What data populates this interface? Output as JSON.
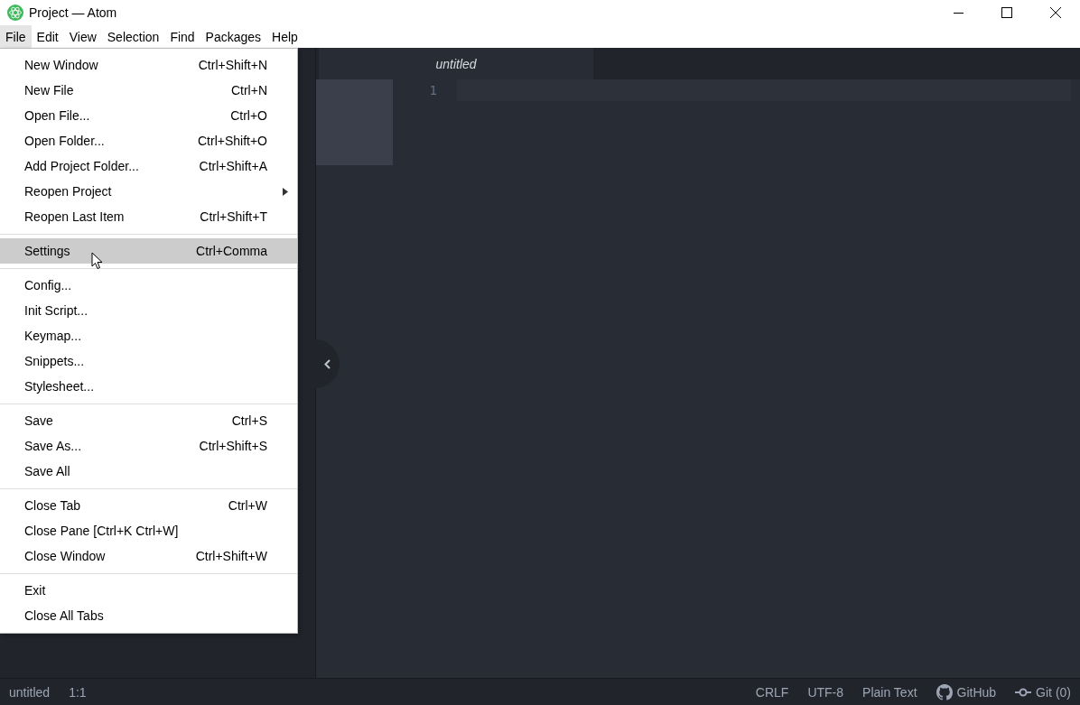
{
  "window": {
    "title": "Project — Atom"
  },
  "menu_bar": [
    {
      "label": "File",
      "selected": true
    },
    {
      "label": "Edit",
      "selected": false
    },
    {
      "label": "View",
      "selected": false
    },
    {
      "label": "Selection",
      "selected": false
    },
    {
      "label": "Find",
      "selected": false
    },
    {
      "label": "Packages",
      "selected": false
    },
    {
      "label": "Help",
      "selected": false
    }
  ],
  "file_menu": [
    [
      {
        "label": "New Window",
        "shortcut": "Ctrl+Shift+N",
        "selected": false
      },
      {
        "label": "New File",
        "shortcut": "Ctrl+N",
        "selected": false
      },
      {
        "label": "Open File...",
        "shortcut": "Ctrl+O",
        "selected": false
      },
      {
        "label": "Open Folder...",
        "shortcut": "Ctrl+Shift+O",
        "selected": false
      },
      {
        "label": "Add Project Folder...",
        "shortcut": "Ctrl+Shift+A",
        "selected": false
      },
      {
        "label": "Reopen Project",
        "submenu": true,
        "selected": false
      },
      {
        "label": "Reopen Last Item",
        "shortcut": "Ctrl+Shift+T",
        "selected": false
      }
    ],
    [
      {
        "label": "Settings",
        "shortcut": "Ctrl+Comma",
        "selected": true
      }
    ],
    [
      {
        "label": "Config...",
        "selected": false
      },
      {
        "label": "Init Script...",
        "selected": false
      },
      {
        "label": "Keymap...",
        "selected": false
      },
      {
        "label": "Snippets...",
        "selected": false
      },
      {
        "label": "Stylesheet...",
        "selected": false
      }
    ],
    [
      {
        "label": "Save",
        "shortcut": "Ctrl+S",
        "selected": false
      },
      {
        "label": "Save As...",
        "shortcut": "Ctrl+Shift+S",
        "selected": false
      },
      {
        "label": "Save All",
        "selected": false
      }
    ],
    [
      {
        "label": "Close Tab",
        "shortcut": "Ctrl+W",
        "selected": false
      },
      {
        "label": "Close Pane [Ctrl+K Ctrl+W]",
        "selected": false
      },
      {
        "label": "Close Window",
        "shortcut": "Ctrl+Shift+W",
        "selected": false
      }
    ],
    [
      {
        "label": "Exit",
        "selected": false
      },
      {
        "label": "Close All Tabs",
        "selected": false
      }
    ]
  ],
  "editor": {
    "tabs": [
      {
        "label": "untitled",
        "selected": true
      }
    ],
    "line_numbers": [
      "1"
    ]
  },
  "status_bar": {
    "left": [
      "untitled",
      "1:1"
    ],
    "right": [
      {
        "kind": "text",
        "label": "CRLF"
      },
      {
        "kind": "text",
        "label": "UTF-8"
      },
      {
        "kind": "text",
        "label": "Plain Text"
      },
      {
        "kind": "github",
        "label": "GitHub"
      },
      {
        "kind": "git",
        "label": "Git (0)"
      }
    ]
  }
}
